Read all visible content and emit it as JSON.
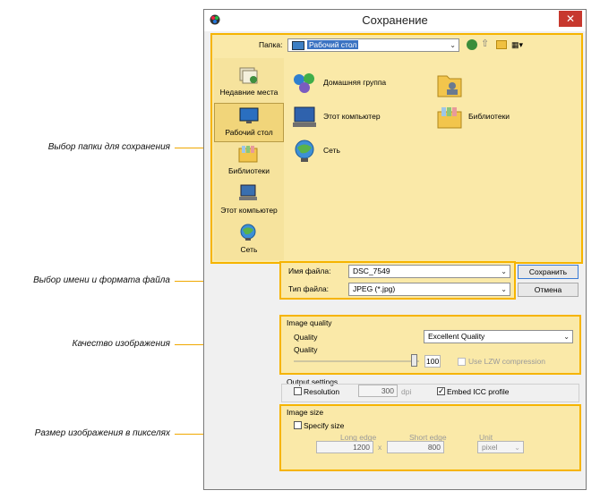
{
  "callouts": {
    "folder": "Выбор папки для сохранения",
    "name_format": "Выбор имени и формата файла",
    "quality": "Качество изображения",
    "size": "Размер изображения в пикселях"
  },
  "dialog": {
    "title": "Сохранение",
    "close": "✕"
  },
  "folder_bar": {
    "label": "Папка:",
    "value": "Рабочий стол"
  },
  "places": [
    {
      "label": "Недавние места",
      "icon": "recent-places-icon"
    },
    {
      "label": "Рабочий стол",
      "icon": "desktop-icon"
    },
    {
      "label": "Библиотеки",
      "icon": "libraries-icon"
    },
    {
      "label": "Этот компьютер",
      "icon": "computer-icon"
    },
    {
      "label": "Сеть",
      "icon": "network-icon"
    }
  ],
  "items": [
    {
      "label": "Домашняя группа",
      "icon": "homegroup-icon"
    },
    {
      "label": "Этот компьютер",
      "icon": "computer-icon"
    },
    {
      "label": "Сеть",
      "icon": "network-icon"
    },
    {
      "label": "",
      "icon": "user-folder-icon"
    },
    {
      "label": "Библиотеки",
      "icon": "libraries-icon"
    }
  ],
  "file": {
    "name_label": "Имя файла:",
    "name_value": "DSC_7549",
    "type_label": "Тип файла:",
    "type_value": "JPEG (*.jpg)",
    "save": "Сохранить",
    "cancel": "Отмена"
  },
  "quality": {
    "group": "Image quality",
    "quality_label": "Quality",
    "quality_value": "Excellent Quality",
    "slider_label": "Quality",
    "slider_value": "100",
    "slider_fraction": 1.0,
    "lzw": "Use LZW compression"
  },
  "output": {
    "group": "Output settings",
    "resolution": "Resolution",
    "resolution_value": "300",
    "unit": "dpi",
    "embed_icc": "Embed ICC profile",
    "embed_checked": true
  },
  "size": {
    "group": "Image size",
    "specify": "Specify size",
    "long_label": "Long edge",
    "short_label": "Short edge",
    "unit_label": "Unit",
    "long_value": "1200",
    "short_value": "800",
    "times": "x",
    "unit_value": "pixel"
  },
  "colors": {
    "highlight": "#f6b400",
    "panel": "#fae9a8",
    "callout_line": "#f0a800"
  }
}
